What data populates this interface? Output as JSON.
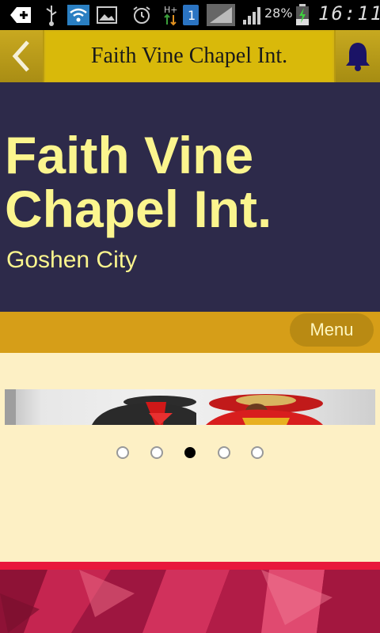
{
  "status_bar": {
    "battery_percent": "28%",
    "time": "16:11",
    "notification_count": "1",
    "icons": [
      "add-icon",
      "usb-icon",
      "wifi-icon",
      "image-icon",
      "alarm-icon",
      "data-arrows-icon",
      "sim-badge-icon",
      "signal-icon",
      "signal-icon",
      "battery-icon"
    ]
  },
  "header": {
    "title": "Faith Vine Chapel Int.",
    "back_icon": "chevron-left-icon",
    "notification_icon": "bell-icon"
  },
  "hero": {
    "title": "Faith Vine Chapel Int.",
    "subtitle": "Goshen City",
    "background_color": "#2d2a4a",
    "text_color": "#fbf58e"
  },
  "menu": {
    "label": "Menu",
    "bar_color": "#d69e18"
  },
  "slider": {
    "total_slides": 5,
    "active_index": 2
  },
  "colors": {
    "header_gold": "#d4b411",
    "content_bg": "#fdf0c5",
    "footer_red": "#b71a45"
  }
}
